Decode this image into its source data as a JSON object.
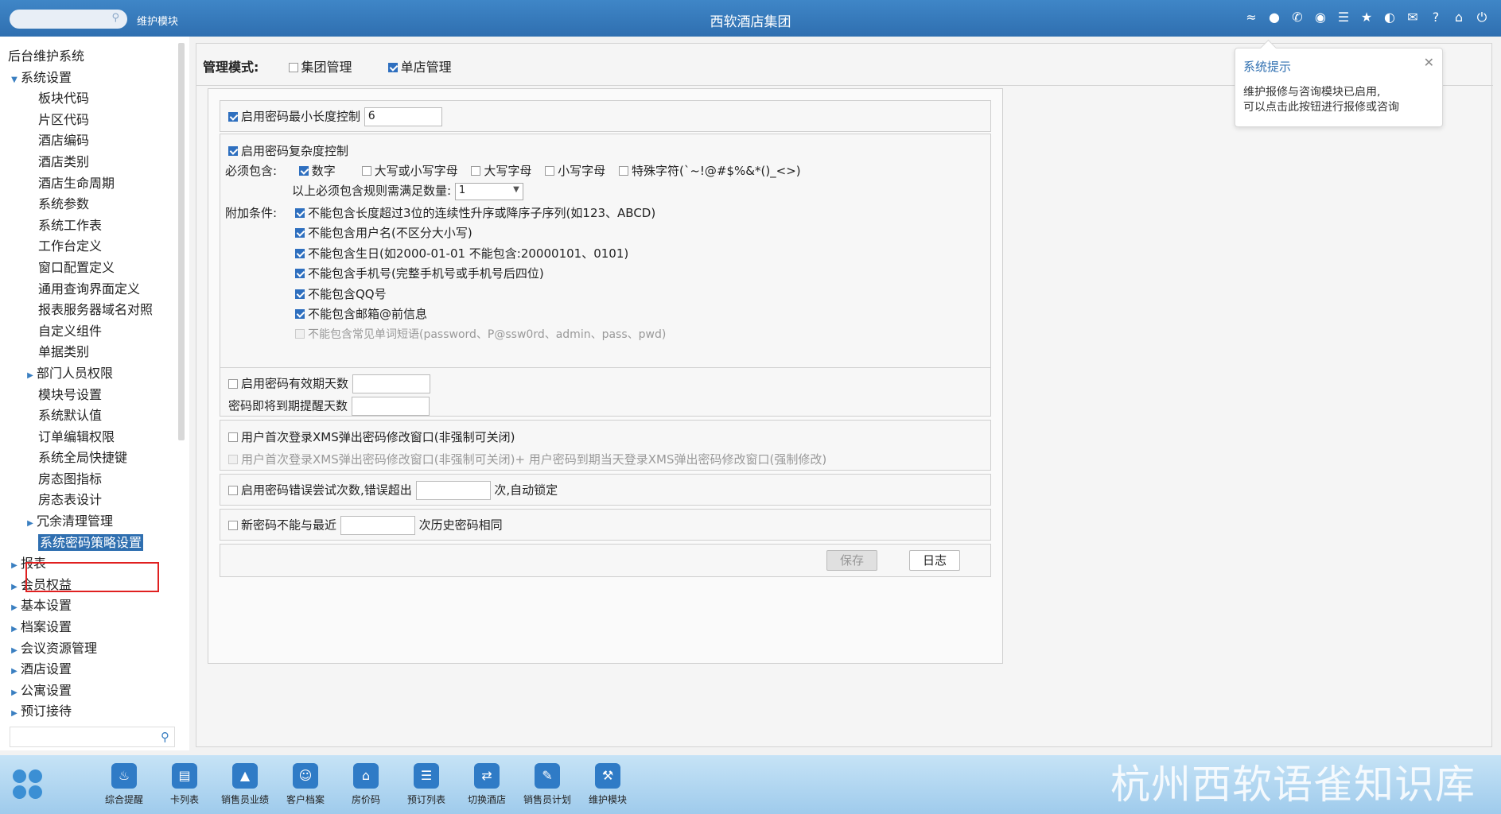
{
  "topbar": {
    "module_label": "维护模块",
    "title": "西软酒店集团",
    "icons": [
      "wifi-icon",
      "chat-icon",
      "phone-icon",
      "palette-icon",
      "menu-icon",
      "star-icon",
      "theme-icon",
      "mail-icon",
      "help-icon",
      "home-icon",
      "power-icon"
    ]
  },
  "sidebar": {
    "root": "后台维护系统",
    "group": "系统设置",
    "items": [
      "板块代码",
      "片区代码",
      "酒店编码",
      "酒店类别",
      "酒店生命周期",
      "系统参数",
      "系统工作表",
      "工作台定义",
      "窗口配置定义",
      "通用查询界面定义",
      "报表服务器域名对照",
      "自定义组件",
      "单据类别"
    ],
    "collapsed1": "部门人员权限",
    "items2": [
      "模块号设置",
      "系统默认值",
      "订单编辑权限",
      "系统全局快捷键",
      "房态图指标",
      "房态表设计"
    ],
    "collapsed2": "冗余清理管理",
    "selected": "系统密码策略设置",
    "top_groups": [
      "报表",
      "会员权益",
      "基本设置",
      "档案设置",
      "会议资源管理",
      "酒店设置",
      "公寓设置",
      "预订接待"
    ]
  },
  "mode": {
    "label": "管理模式:",
    "opt1": "集团管理",
    "opt2": "单店管理"
  },
  "policy": {
    "min_len_label": "启用密码最小长度控制",
    "min_len_value": "6",
    "complexity_label": "启用密码复杂度控制",
    "must_include": "必须包含:",
    "inc_digit": "数字",
    "inc_case": "大写或小写字母",
    "inc_upper": "大写字母",
    "inc_lower": "小写字母",
    "inc_special": "特殊字符(`~!@#$%&*()_<>)",
    "rule_count_label": "以上必须包含规则需满足数量:",
    "rule_count_value": "1",
    "extra_label": "附加条件:",
    "extra1": "不能包含长度超过3位的连续性升序或降序子序列(如123、ABCD)",
    "extra2": "不能包含用户名(不区分大小写)",
    "extra3": "不能包含生日(如2000-01-01 不能包含:20000101、0101)",
    "extra4": "不能包含手机号(完整手机号或手机号后四位)",
    "extra5": "不能包含QQ号",
    "extra6": "不能包含邮箱@前信息",
    "extra7": "不能包含常见单词短语(password、P@ssw0rd、admin、pass、pwd)",
    "valid_days_label": "启用密码有效期天数",
    "remind_days_label": "密码即将到期提醒天数",
    "first_login_label": "用户首次登录XMS弹出密码修改窗口(非强制可关闭)",
    "first_login_force_label": "用户首次登录XMS弹出密码修改窗口(非强制可关闭)+ 用户密码到期当天登录XMS弹出密码修改窗口(强制修改)",
    "lock_label": "启用密码错误尝试次数,错误超出",
    "lock_suffix": "次,自动锁定",
    "history_label": "新密码不能与最近",
    "history_suffix": "次历史密码相同",
    "save_btn": "保存",
    "log_btn": "日志"
  },
  "tip": {
    "title": "系统提示",
    "line1": "维护报修与咨询模块已启用,",
    "line2": "可以点击此按钮进行报修或咨询"
  },
  "taskbar": {
    "apps": [
      "综合提醒",
      "卡列表",
      "销售员业绩",
      "客户档案",
      "房价码",
      "预订列表",
      "切换酒店",
      "销售员计划",
      "维护模块"
    ],
    "watermark": "杭州西软语雀知识库"
  }
}
